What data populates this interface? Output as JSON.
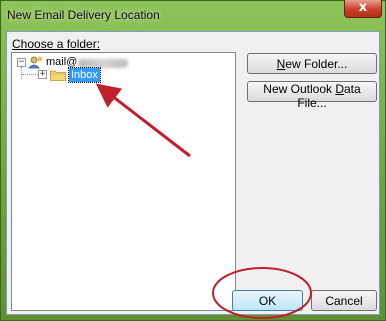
{
  "window": {
    "title": "New Email Delivery Location",
    "close_label": "x"
  },
  "dialog": {
    "choose_label": "Choose a folder:",
    "tree": {
      "account_prefix": "mail@",
      "selected_folder": "Inbox"
    },
    "buttons": {
      "new_folder": {
        "before": "",
        "underlined": "N",
        "after": "ew Folder..."
      },
      "new_data_file": {
        "before": "New Outlook ",
        "underlined": "D",
        "after": "ata File..."
      },
      "ok": "OK",
      "cancel": "Cancel"
    }
  },
  "colors": {
    "annotation_red": "#c0202a",
    "selection_blue": "#3399ff"
  }
}
